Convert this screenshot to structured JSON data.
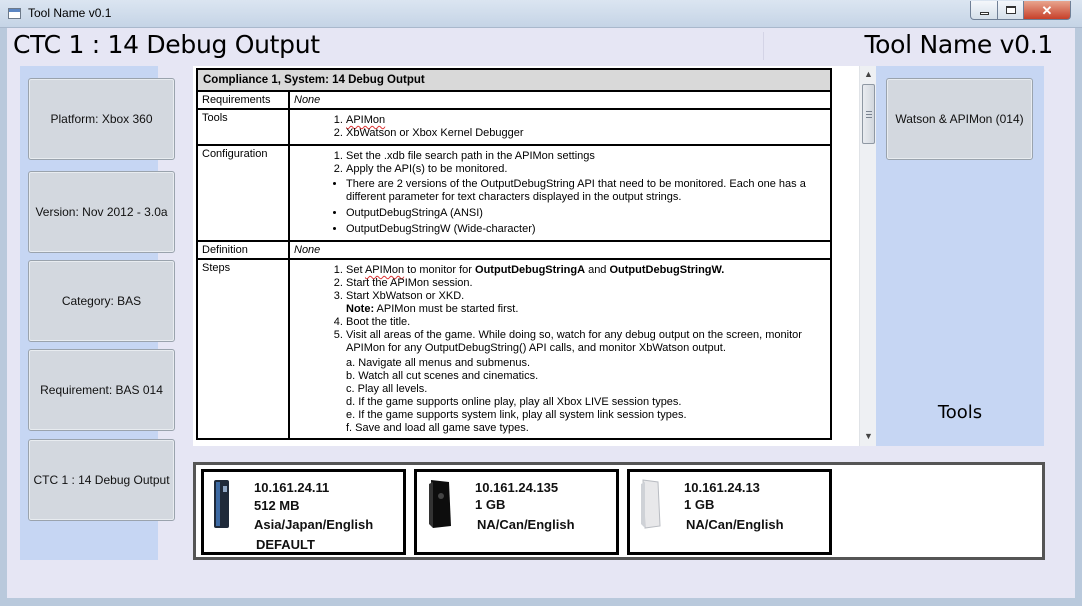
{
  "window": {
    "title": "Tool Name v0.1"
  },
  "header": {
    "left": "CTC 1 : 14 Debug Output",
    "right": "Tool Name v0.1"
  },
  "left_panel": {
    "tiles": [
      "Platform: Xbox 360",
      "Version: Nov 2012 - 3.0a",
      "Category: BAS",
      "Requirement: BAS 014",
      "CTC 1 : 14 Debug Output"
    ]
  },
  "right_panel": {
    "tile": "Watson & APIMon (014)",
    "label": "Tools"
  },
  "document": {
    "heading": "Compliance 1, System: 14 Debug Output",
    "requirements": {
      "label": "Requirements",
      "value": "None"
    },
    "tools": {
      "label": "Tools",
      "items": [
        "APIMon",
        "XbWatson or Xbox Kernel Debugger"
      ]
    },
    "configuration": {
      "label": "Configuration",
      "items": [
        "Set the .xdb file search path in the APIMon settings",
        "Apply the API(s) to be monitored."
      ],
      "bullets": [
        "There are 2 versions of the OutputDebugString API that need to be monitored. Each one has a different parameter for text characters displayed in the output strings.",
        "OutputDebugStringA (ANSI)",
        "OutputDebugStringW (Wide-character)"
      ]
    },
    "definition": {
      "label": "Definition",
      "value": "None"
    },
    "steps": {
      "label": "Steps",
      "s1_pre": "Set ",
      "s1_apimon": "APIMon",
      "s1_mid": " to monitor for ",
      "s1_a": "OutputDebugStringA",
      "s1_and": " and ",
      "s1_w": "OutputDebugStringW.",
      "s2": "Start the APIMon session.",
      "s3": "Start XbWatson or XKD.",
      "s3_note_label": "Note:",
      "s3_note": " APIMon must be started first.",
      "s4": "Boot the title.",
      "s5": "Visit all areas of the game. While doing so, watch for any debug output on the screen, monitor APIMon for any OutputDebugString() API calls, and monitor XbWatson output.",
      "sub": [
        "a.  Navigate all menus and submenus.",
        "b. Watch all cut scenes and cinematics.",
        "c. Play all levels.",
        "d. If the game supports online play, play all Xbox LIVE session types.",
        "e. If the game supports system link, play all system link session types.",
        "f. Save and load all game save types."
      ]
    }
  },
  "consoles": [
    {
      "ip": "10.161.24.11",
      "mem": "512 MB",
      "region": "Asia/Japan/English",
      "tag": "DEFAULT",
      "color": "#1f2a3a"
    },
    {
      "ip": "10.161.24.135",
      "mem": "1 GB",
      "region": "NA/Can/English",
      "tag": "",
      "color": "#0d0d0d"
    },
    {
      "ip": "10.161.24.13",
      "mem": "1 GB",
      "region": "NA/Can/English",
      "tag": "",
      "color": "#e8e8ea"
    }
  ]
}
